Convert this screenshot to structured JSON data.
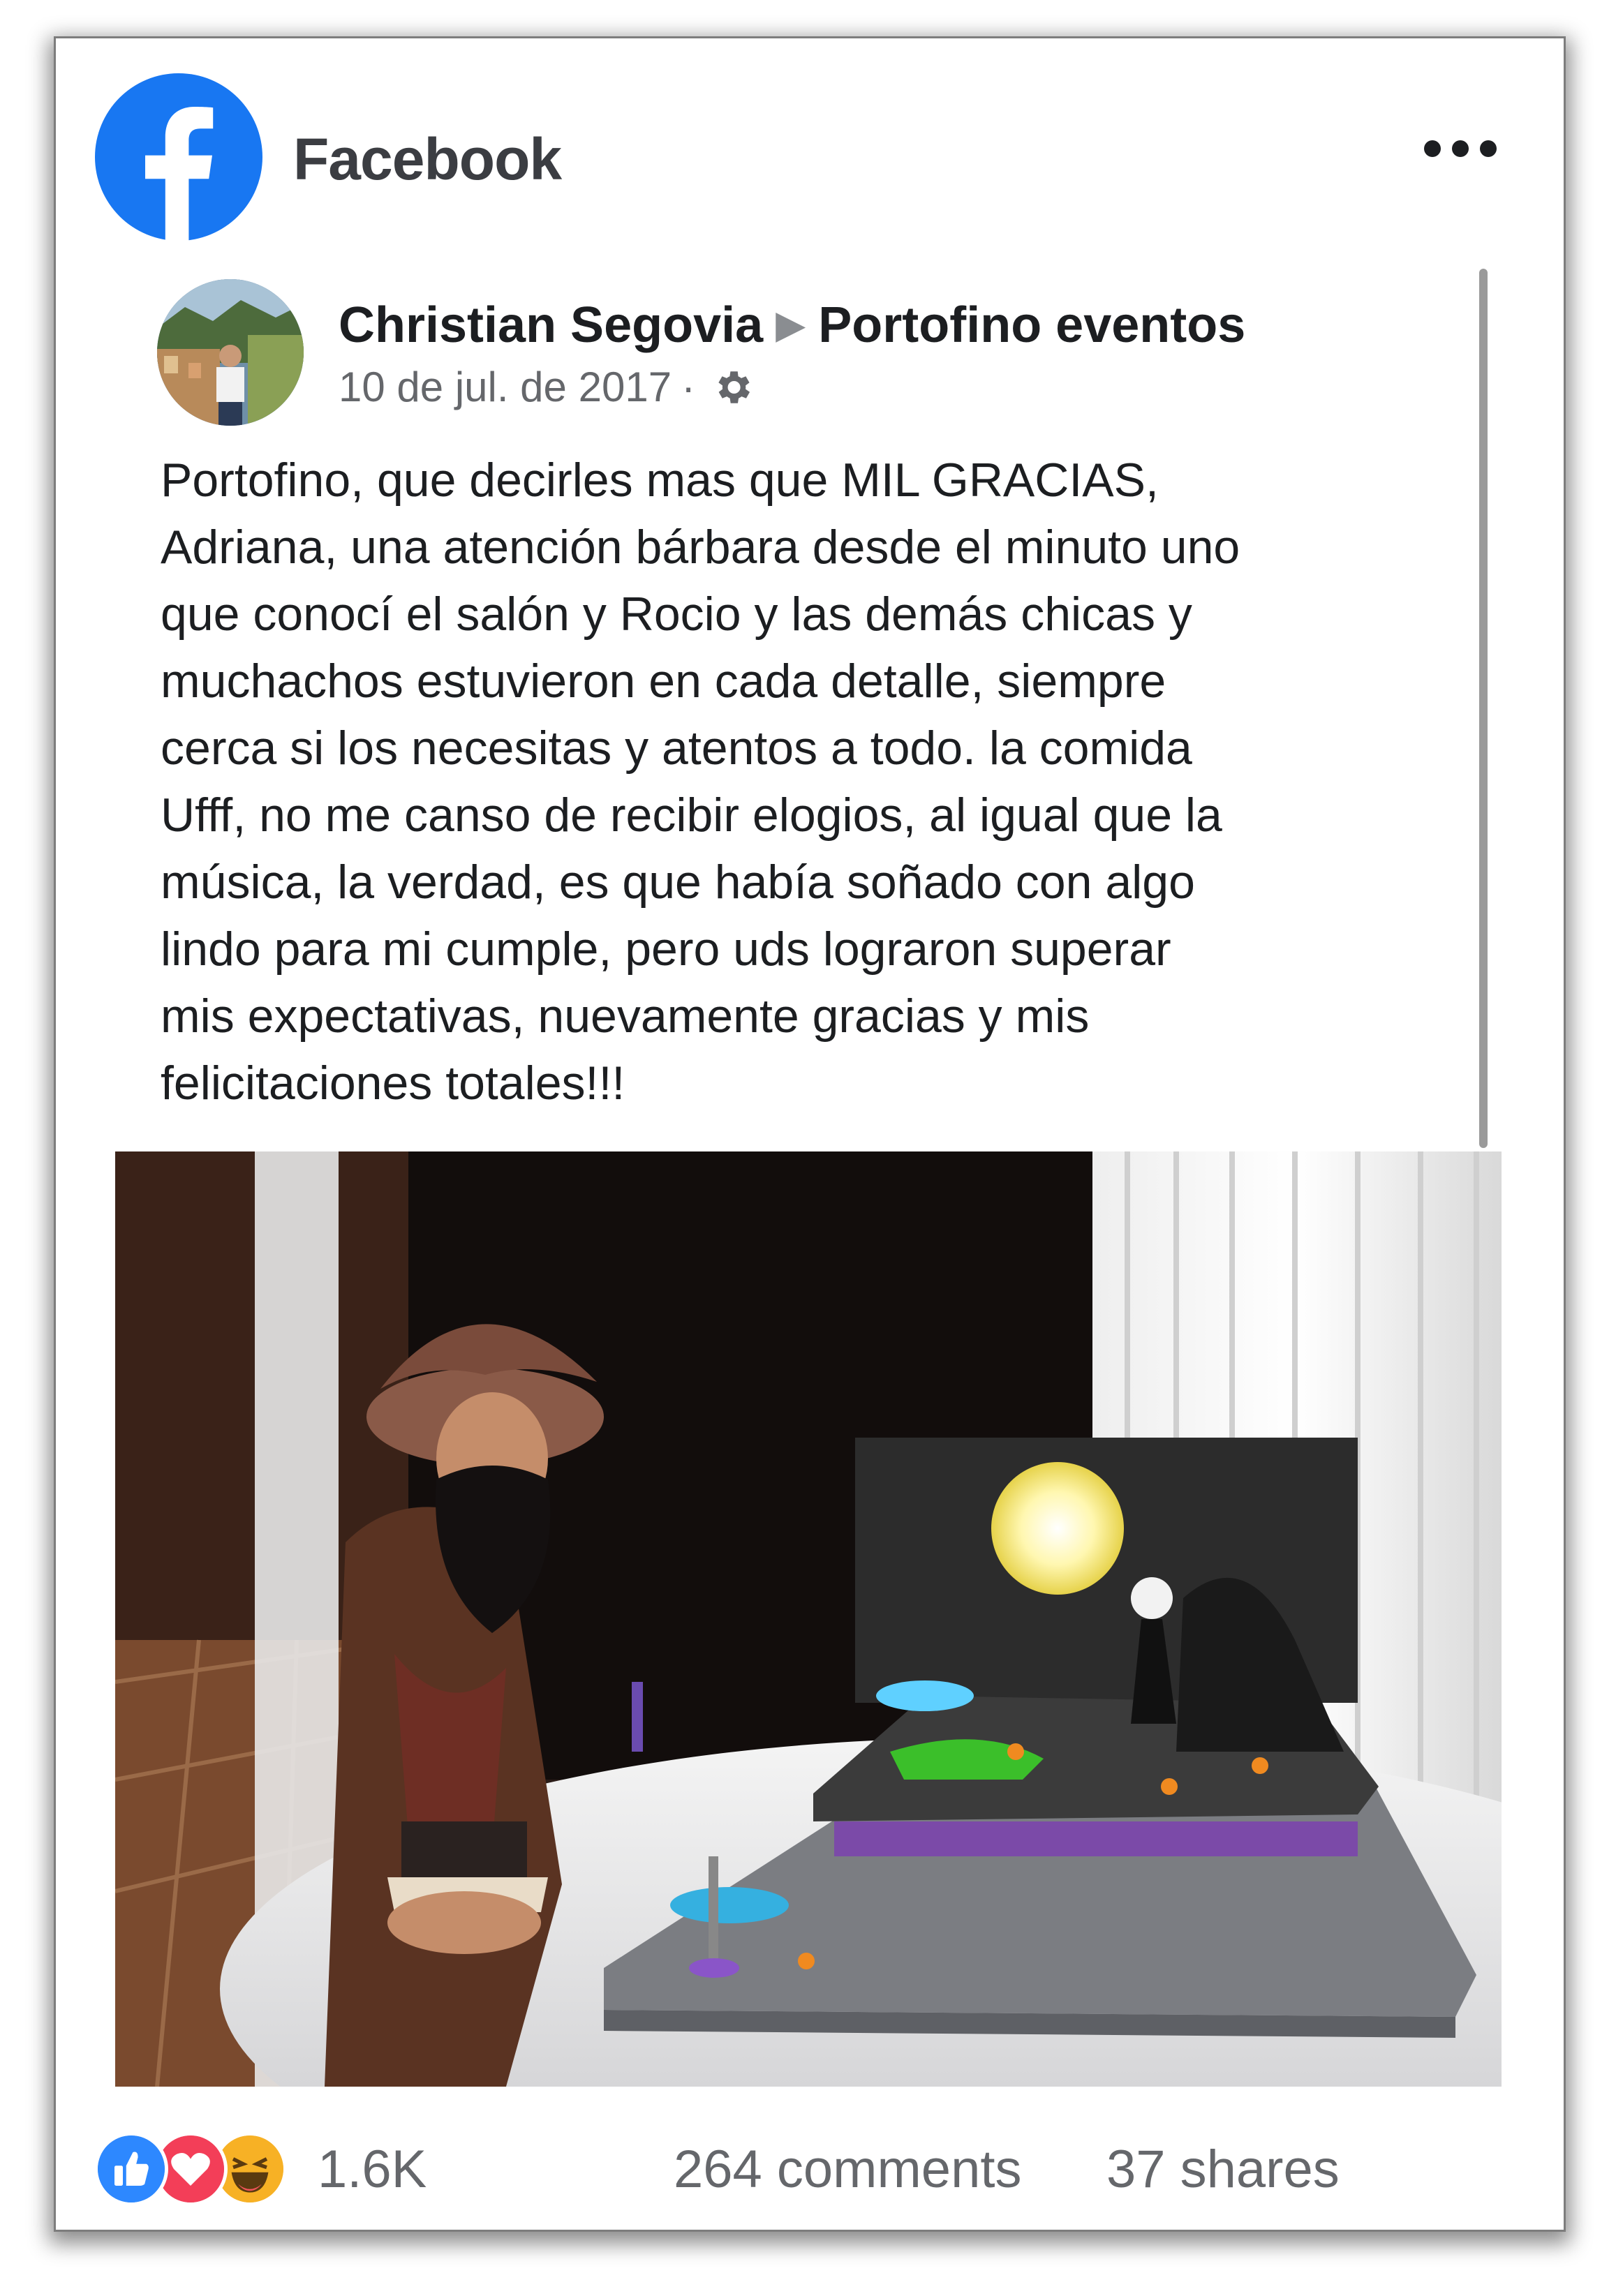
{
  "header": {
    "app_title": "Facebook"
  },
  "post": {
    "author": "Christian Segovia",
    "target_page": "Portofino eventos",
    "date": "10 de jul. de 2017",
    "separator": "·",
    "text": "Portofino, que decirles mas que MIL GRACIAS,\nAdriana, una atención bárbara desde el minuto uno\nque conocí el salón y Rocio y las demás chicas y\nmuchachos estuvieron en cada detalle, siempre\ncerca si los necesitas y atentos a todo. la comida\nUfff, no me canso de recibir elogios, al igual que la\nmúsica, la verdad, es que había soñado con algo\nlindo para mi cumple, pero uds lograron superar\nmis expectativas, nuevamente gracias y mis\nfelicitaciones totales!!!"
  },
  "stats": {
    "reactions_count": "1.6K",
    "comments": "264 comments",
    "shares": "37 shares"
  },
  "colors": {
    "facebook_blue": "#1877f2",
    "like_blue": "#2d88ff",
    "love_red": "#f33e58",
    "haha_yellow": "#f7b125",
    "text_primary": "#1c1e21",
    "text_secondary": "#65676b"
  },
  "icons": [
    "facebook-logo-icon",
    "more-options-icon",
    "arrow-right-icon",
    "globe-gear-icon",
    "like-reaction-icon",
    "love-reaction-icon",
    "haha-reaction-icon"
  ]
}
